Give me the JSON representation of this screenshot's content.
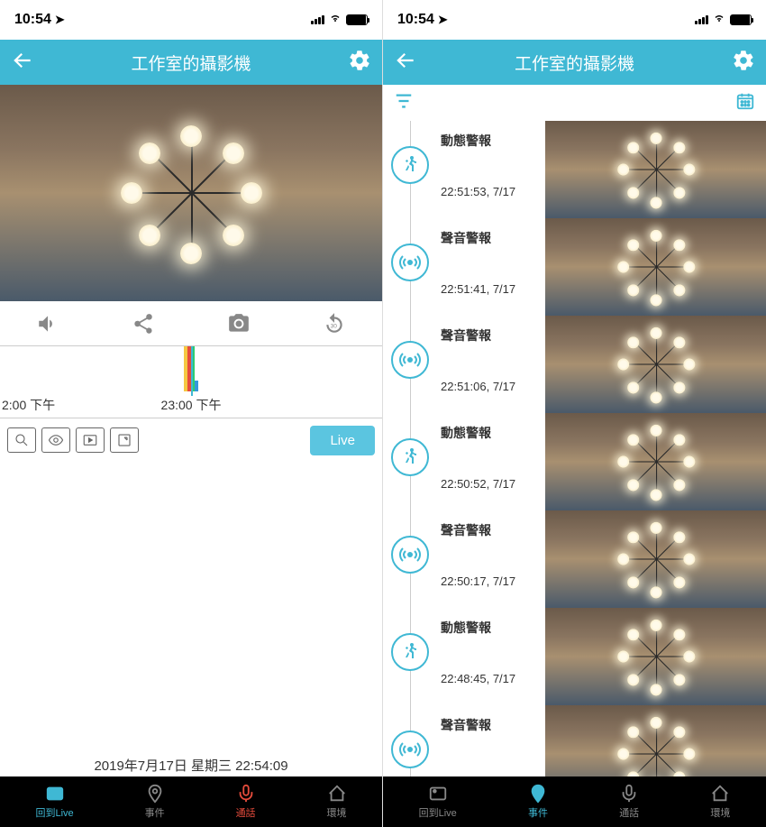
{
  "status": {
    "time": "10:54"
  },
  "header": {
    "title": "工作室的攝影機"
  },
  "timeline": {
    "left_label": "2:00 下午",
    "center_label": "23:00 下午"
  },
  "live_button": "Live",
  "footer_timestamp": "2019年7月17日 星期三 22:54:09",
  "tabs": {
    "live": "回到Live",
    "events": "事件",
    "talk": "通話",
    "env": "環境"
  },
  "events": [
    {
      "type": "動態警報",
      "time": "22:51:53, 7/17",
      "icon": "motion"
    },
    {
      "type": "聲音警報",
      "time": "22:51:41, 7/17",
      "icon": "sound"
    },
    {
      "type": "聲音警報",
      "time": "22:51:06, 7/17",
      "icon": "sound"
    },
    {
      "type": "動態警報",
      "time": "22:50:52, 7/17",
      "icon": "motion"
    },
    {
      "type": "聲音警報",
      "time": "22:50:17, 7/17",
      "icon": "sound"
    },
    {
      "type": "動態警報",
      "time": "22:48:45, 7/17",
      "icon": "motion"
    },
    {
      "type": "聲音警報",
      "time": "",
      "icon": "sound"
    }
  ]
}
